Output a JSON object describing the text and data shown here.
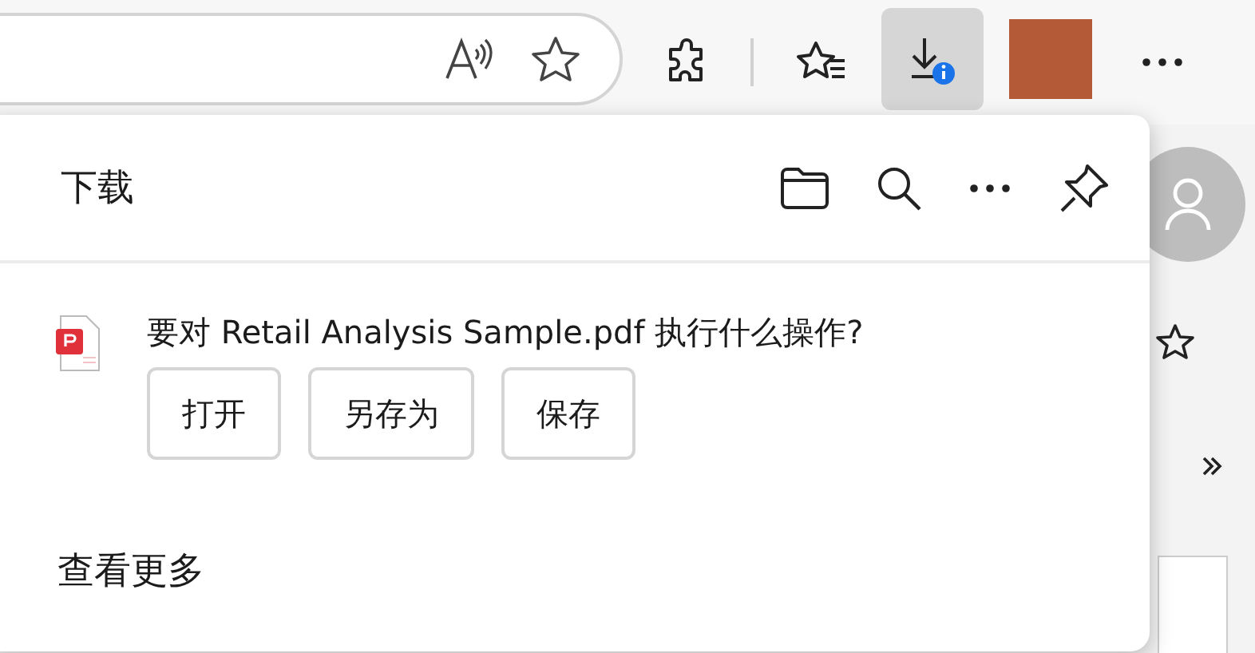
{
  "toolbar": {
    "download_button": {
      "active": true
    }
  },
  "downloads_panel": {
    "title": "下载",
    "item": {
      "prompt": "要对 Retail Analysis Sample.pdf 执行什么操作?",
      "actions": [
        "打开",
        "另存为",
        "保存"
      ]
    },
    "footer_link": "查看更多"
  }
}
